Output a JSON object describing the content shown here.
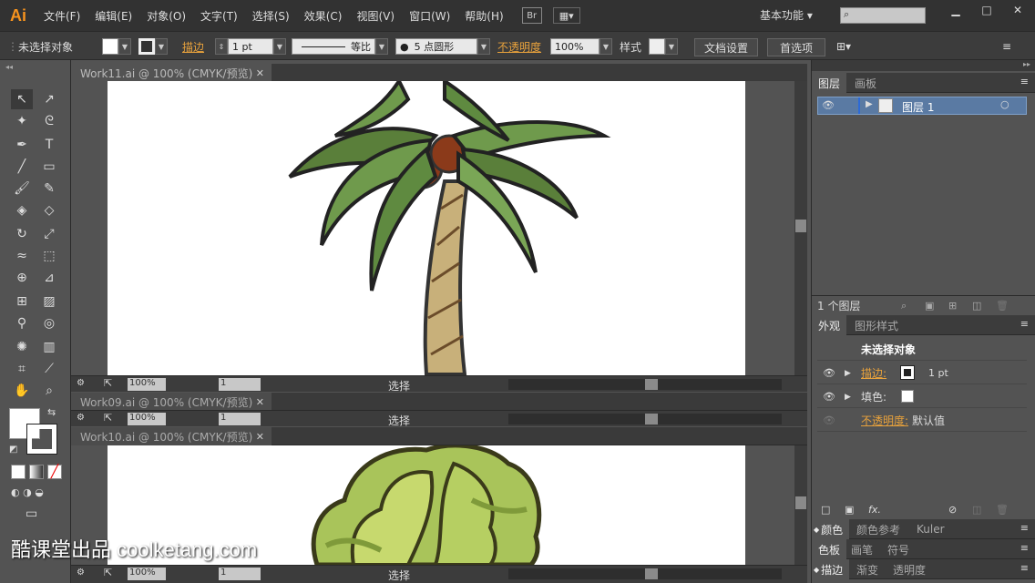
{
  "app": {
    "logo": "Ai",
    "workspace": "基本功能 ▾",
    "br": "Br"
  },
  "menu": [
    "文件(F)",
    "编辑(E)",
    "对象(O)",
    "文字(T)",
    "选择(S)",
    "效果(C)",
    "视图(V)",
    "窗口(W)",
    "帮助(H)"
  ],
  "control": {
    "selection": "未选择对象",
    "stroke_label": "描边",
    "stroke_weight": "1 pt",
    "profile": "等比",
    "brush": "5 点圆形",
    "opacity_label": "不透明度",
    "opacity": "100%",
    "style_label": "样式",
    "doc_settings": "文档设置",
    "preferences": "首选项"
  },
  "documents": [
    {
      "title": "Work11.ai @ 100% (CMYK/预览)",
      "zoom": "100%",
      "page": "1",
      "status": "选择"
    },
    {
      "title": "Work09.ai @ 100% (CMYK/预览)",
      "zoom": "100%",
      "page": "1",
      "status": "选择"
    },
    {
      "title": "Work10.ai @ 100% (CMYK/预览)",
      "zoom": "100%",
      "page": "1",
      "status": "选择"
    }
  ],
  "layers_panel": {
    "tabs": [
      "图层",
      "画板"
    ],
    "layer_name": "图层 1",
    "footer": "1 个图层"
  },
  "appearance_panel": {
    "tabs": [
      "外观",
      "图形样式"
    ],
    "heading": "未选择对象",
    "stroke_label": "描边:",
    "stroke_value": "1 pt",
    "fill_label": "填色:",
    "opacity_label": "不透明度:",
    "opacity_value": "默认值"
  },
  "collapsed_panels": [
    {
      "tabs": [
        "颜色",
        "颜色参考",
        "Kuler"
      ]
    },
    {
      "tabs": [
        "色板",
        "画笔",
        "符号"
      ]
    },
    {
      "tabs": [
        "描边",
        "渐变",
        "透明度"
      ]
    }
  ],
  "watermark": "酷课堂出品 coolketang.com",
  "colors": {
    "accent": "#e8a23c",
    "selection": "#5a7aa3",
    "bg": "#535353"
  }
}
